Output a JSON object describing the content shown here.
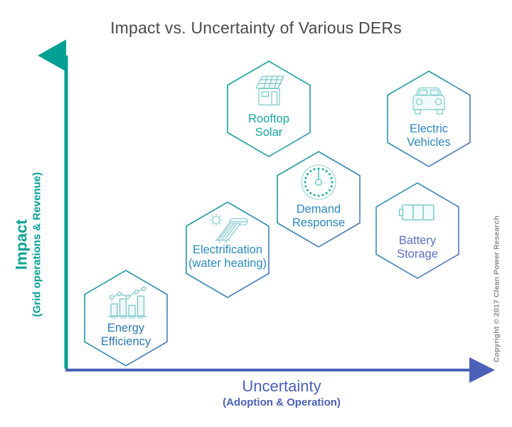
{
  "title": "Impact vs. Uncertainty of Various DERs",
  "axes": {
    "y": {
      "main": "Impact",
      "sub": "(Grid operations & Revenue)",
      "color": "#05a094"
    },
    "x": {
      "main": "Uncertainty",
      "sub": "(Adoption & Operation)",
      "color": "#4a61b5"
    }
  },
  "copyright": "Copyright © 2017 Clean Power Research",
  "colors": {
    "gradient_start": "#11a39a",
    "gradient_end": "#5b6fc0",
    "title": "#4a4a4a"
  },
  "chart_data": {
    "type": "scatter",
    "title": "Impact vs. Uncertainty of Various DERs",
    "xlabel": "Uncertainty (Adoption & Operation)",
    "ylabel": "Impact (Grid operations & Revenue)",
    "xlim": [
      0,
      10
    ],
    "ylim": [
      0,
      10
    ],
    "grid": false,
    "legend": "none",
    "points": [
      {
        "label": "Energy Efficiency",
        "x": 0.8,
        "y": 1.1,
        "icon": "bar-chart-line-icon"
      },
      {
        "label": "Electrification (water heating)",
        "x": 3.1,
        "y": 3.3,
        "icon": "solar-water-heater-icon"
      },
      {
        "label": "Rooftop Solar",
        "x": 4.6,
        "y": 8.3,
        "icon": "house-solar-panel-icon"
      },
      {
        "label": "Demand Response",
        "x": 5.9,
        "y": 6.0,
        "icon": "gauge-meter-icon"
      },
      {
        "label": "Electric Vehicles",
        "x": 8.4,
        "y": 8.1,
        "icon": "car-front-icon"
      },
      {
        "label": "Battery Storage",
        "x": 8.2,
        "y": 4.3,
        "icon": "battery-icon"
      }
    ]
  },
  "hexagons": [
    {
      "id": "energy-efficiency",
      "lines": [
        "Energy",
        "Efficiency"
      ],
      "icon": "bar-chart-line-icon",
      "label_color": "#2b7ab0",
      "stroke_start": "#17a39c",
      "stroke_end": "#4f74c2"
    },
    {
      "id": "electrification",
      "lines": [
        "Electrification",
        "(water heating)"
      ],
      "icon": "solar-water-heater-icon",
      "label_color": "#2b8bbd",
      "stroke_start": "#15a49c",
      "stroke_end": "#4f74c2"
    },
    {
      "id": "rooftop-solar",
      "lines": [
        "Rooftop",
        "Solar"
      ],
      "icon": "house-solar-panel-icon",
      "label_color": "#17a8a0",
      "stroke_start": "#11a39a",
      "stroke_end": "#2f9bb0"
    },
    {
      "id": "demand-response",
      "lines": [
        "Demand",
        "Response"
      ],
      "icon": "gauge-meter-icon",
      "label_color": "#2b86bd",
      "stroke_start": "#17a39c",
      "stroke_end": "#5b6fc0"
    },
    {
      "id": "electric-vehicles",
      "lines": [
        "Electric",
        "Vehicles"
      ],
      "icon": "car-front-icon",
      "label_color": "#2d87c0",
      "stroke_start": "#15a49c",
      "stroke_end": "#5b6fc0"
    },
    {
      "id": "battery-storage",
      "lines": [
        "Battery",
        "Storage"
      ],
      "icon": "battery-icon",
      "label_color": "#5b6fc0",
      "stroke_start": "#2f9bb0",
      "stroke_end": "#5b6fc0"
    }
  ]
}
